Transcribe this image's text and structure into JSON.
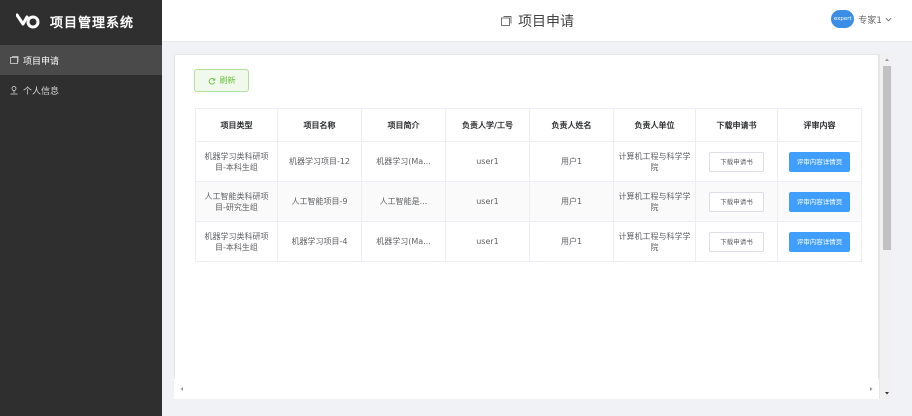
{
  "app": {
    "title": "项目管理系统"
  },
  "sidebar": {
    "items": [
      {
        "label": "项目申请",
        "icon": "document-icon",
        "active": true
      },
      {
        "label": "个人信息",
        "icon": "user-icon",
        "active": false
      }
    ]
  },
  "header": {
    "title": "项目申请",
    "user": {
      "avatar_text": "expert",
      "name": "专家1"
    }
  },
  "toolbar": {
    "refresh_label": "刷新"
  },
  "table": {
    "columns": [
      "项目类型",
      "项目名称",
      "项目简介",
      "负责人学/工号",
      "负责人姓名",
      "负责人单位",
      "下载申请书",
      "评审内容"
    ],
    "rows": [
      {
        "type": "机器学习类科研项目-本科生组",
        "name": "机器学习项目-12",
        "intro": "机器学习(Ma...",
        "leader_id": "user1",
        "leader_name": "用户1",
        "unit": "计算机工程与科学学院",
        "download_label": "下载申请书",
        "review_label": "评审内容详情页"
      },
      {
        "type": "人工智能类科研项目-研究生组",
        "name": "人工智能项目-9",
        "intro": "人工智能是...",
        "leader_id": "user1",
        "leader_name": "用户1",
        "unit": "计算机工程与科学学院",
        "download_label": "下载申请书",
        "review_label": "评审内容详情页"
      },
      {
        "type": "机器学习类科研项目-本科生组",
        "name": "机器学习项目-4",
        "intro": "机器学习(Ma...",
        "leader_id": "user1",
        "leader_name": "用户1",
        "unit": "计算机工程与科学学院",
        "download_label": "下载申请书",
        "review_label": "评审内容详情页"
      }
    ]
  },
  "colors": {
    "sidebar_bg": "#2f2f2f",
    "primary": "#409eff",
    "success": "#67c23a"
  }
}
